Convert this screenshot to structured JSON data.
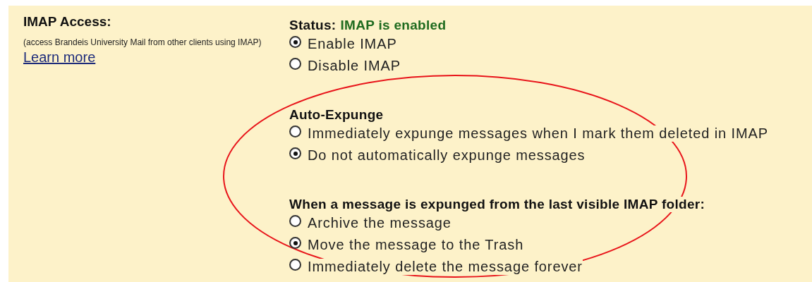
{
  "sidebar": {
    "title": "IMAP Access:",
    "description": "(access Brandeis University Mail from other clients using IMAP)",
    "link": "Learn more"
  },
  "status": {
    "label": "Status:",
    "value": "IMAP is enabled"
  },
  "groups": [
    {
      "options": [
        {
          "label": "Enable IMAP",
          "selected": true
        },
        {
          "label": "Disable IMAP",
          "selected": false
        }
      ]
    },
    {
      "heading": "Auto-Expunge",
      "options": [
        {
          "label": "Immediately expunge messages when I mark them deleted in IMAP",
          "selected": false
        },
        {
          "label": "Do not automatically expunge messages",
          "selected": true
        }
      ]
    },
    {
      "heading": "When a message is expunged from the last visible IMAP folder:",
      "options": [
        {
          "label": "Archive the message",
          "selected": false
        },
        {
          "label": "Move the message to the Trash",
          "selected": true
        },
        {
          "label": "Immediately delete the message forever",
          "selected": false
        }
      ]
    }
  ]
}
